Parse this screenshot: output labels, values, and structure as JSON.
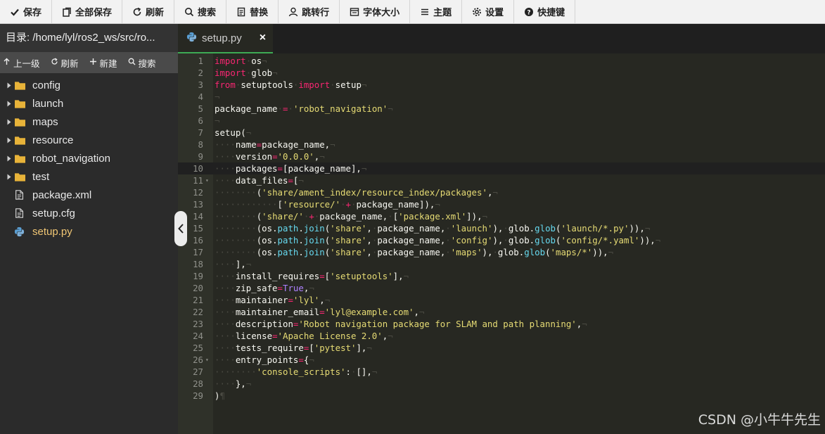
{
  "toolbar": {
    "save": "保存",
    "save_all": "全部保存",
    "refresh": "刷新",
    "search": "搜索",
    "replace": "替换",
    "goto_line": "跳转行",
    "font_size": "字体大小",
    "theme": "主题",
    "settings": "设置",
    "shortcuts": "快捷键"
  },
  "sidebar": {
    "path_label": "目录: /home/lyl/ros2_ws/src/ro...",
    "actions": {
      "up": "上一级",
      "refresh": "刷新",
      "new": "新建",
      "search": "搜索"
    },
    "folders": [
      "config",
      "launch",
      "maps",
      "resource",
      "robot_navigation",
      "test"
    ],
    "files": [
      "package.xml",
      "setup.cfg",
      "setup.py"
    ]
  },
  "tab": {
    "title": "setup.py",
    "close": "×"
  },
  "editor": {
    "current_line": 10,
    "lines": [
      [
        [
          "k",
          "import"
        ],
        [
          "w",
          " "
        ],
        [
          "t",
          "os"
        ]
      ],
      [
        [
          "k",
          "import"
        ],
        [
          "w",
          " "
        ],
        [
          "t",
          "glob"
        ]
      ],
      [
        [
          "k",
          "from"
        ],
        [
          "w",
          " "
        ],
        [
          "t",
          "setuptools"
        ],
        [
          "w",
          " "
        ],
        [
          "k",
          "import"
        ],
        [
          "w",
          " "
        ],
        [
          "t",
          "setup"
        ]
      ],
      [],
      [
        [
          "t",
          "package_name"
        ],
        [
          "w",
          " "
        ],
        [
          "o",
          "="
        ],
        [
          "w",
          " "
        ],
        [
          "s",
          "'robot_navigation'"
        ]
      ],
      [],
      [
        [
          "t",
          "setup("
        ]
      ],
      [
        [
          "w",
          "    "
        ],
        [
          "t",
          "name"
        ],
        [
          "o",
          "="
        ],
        [
          "t",
          "package_name,"
        ]
      ],
      [
        [
          "w",
          "    "
        ],
        [
          "t",
          "version"
        ],
        [
          "o",
          "="
        ],
        [
          "s",
          "'0.0.0'"
        ],
        [
          "t",
          ","
        ]
      ],
      [
        [
          "w",
          "    "
        ],
        [
          "t",
          "packages"
        ],
        [
          "o",
          "="
        ],
        [
          "t",
          "[package_name],"
        ]
      ],
      [
        [
          "w",
          "    "
        ],
        [
          "t",
          "data_files"
        ],
        [
          "o",
          "="
        ],
        [
          "t",
          "["
        ]
      ],
      [
        [
          "w",
          "        "
        ],
        [
          "t",
          "("
        ],
        [
          "s",
          "'share/ament_index/resource_index/packages'"
        ],
        [
          "t",
          ","
        ]
      ],
      [
        [
          "w",
          "            "
        ],
        [
          "t",
          "["
        ],
        [
          "s",
          "'resource/'"
        ],
        [
          "w",
          " "
        ],
        [
          "o",
          "+"
        ],
        [
          "w",
          " "
        ],
        [
          "t",
          "package_name]),"
        ]
      ],
      [
        [
          "w",
          "        "
        ],
        [
          "t",
          "("
        ],
        [
          "s",
          "'share/'"
        ],
        [
          "w",
          " "
        ],
        [
          "o",
          "+"
        ],
        [
          "w",
          " "
        ],
        [
          "t",
          "package_name,"
        ],
        [
          "w",
          " "
        ],
        [
          "t",
          "["
        ],
        [
          "s",
          "'package.xml'"
        ],
        [
          "t",
          "]),"
        ]
      ],
      [
        [
          "w",
          "        "
        ],
        [
          "t",
          "(os."
        ],
        [
          "f",
          "path"
        ],
        [
          "t",
          "."
        ],
        [
          "f",
          "join"
        ],
        [
          "t",
          "("
        ],
        [
          "s",
          "'share'"
        ],
        [
          "t",
          ","
        ],
        [
          "w",
          " "
        ],
        [
          "t",
          "package_name,"
        ],
        [
          "w",
          " "
        ],
        [
          "s",
          "'launch'"
        ],
        [
          "t",
          "),"
        ],
        [
          "w",
          " "
        ],
        [
          "t",
          "glob."
        ],
        [
          "f",
          "glob"
        ],
        [
          "t",
          "("
        ],
        [
          "s",
          "'launch/*.py'"
        ],
        [
          "t",
          ")),"
        ]
      ],
      [
        [
          "w",
          "        "
        ],
        [
          "t",
          "(os."
        ],
        [
          "f",
          "path"
        ],
        [
          "t",
          "."
        ],
        [
          "f",
          "join"
        ],
        [
          "t",
          "("
        ],
        [
          "s",
          "'share'"
        ],
        [
          "t",
          ","
        ],
        [
          "w",
          " "
        ],
        [
          "t",
          "package_name,"
        ],
        [
          "w",
          " "
        ],
        [
          "s",
          "'config'"
        ],
        [
          "t",
          "),"
        ],
        [
          "w",
          " "
        ],
        [
          "t",
          "glob."
        ],
        [
          "f",
          "glob"
        ],
        [
          "t",
          "("
        ],
        [
          "s",
          "'config/*.yaml'"
        ],
        [
          "t",
          ")),"
        ]
      ],
      [
        [
          "w",
          "        "
        ],
        [
          "t",
          "(os."
        ],
        [
          "f",
          "path"
        ],
        [
          "t",
          "."
        ],
        [
          "f",
          "join"
        ],
        [
          "t",
          "("
        ],
        [
          "s",
          "'share'"
        ],
        [
          "t",
          ","
        ],
        [
          "w",
          " "
        ],
        [
          "t",
          "package_name,"
        ],
        [
          "w",
          " "
        ],
        [
          "s",
          "'maps'"
        ],
        [
          "t",
          "),"
        ],
        [
          "w",
          " "
        ],
        [
          "t",
          "glob."
        ],
        [
          "f",
          "glob"
        ],
        [
          "t",
          "("
        ],
        [
          "s",
          "'maps/*'"
        ],
        [
          "t",
          ")),"
        ]
      ],
      [
        [
          "w",
          "    "
        ],
        [
          "t",
          "],"
        ]
      ],
      [
        [
          "w",
          "    "
        ],
        [
          "t",
          "install_requires"
        ],
        [
          "o",
          "="
        ],
        [
          "t",
          "["
        ],
        [
          "s",
          "'setuptools'"
        ],
        [
          "t",
          "],"
        ]
      ],
      [
        [
          "w",
          "    "
        ],
        [
          "t",
          "zip_safe"
        ],
        [
          "o",
          "="
        ],
        [
          "b",
          "True"
        ],
        [
          "t",
          ","
        ]
      ],
      [
        [
          "w",
          "    "
        ],
        [
          "t",
          "maintainer"
        ],
        [
          "o",
          "="
        ],
        [
          "s",
          "'lyl'"
        ],
        [
          "t",
          ","
        ]
      ],
      [
        [
          "w",
          "    "
        ],
        [
          "t",
          "maintainer_email"
        ],
        [
          "o",
          "="
        ],
        [
          "s",
          "'lyl@example.com'"
        ],
        [
          "t",
          ","
        ]
      ],
      [
        [
          "w",
          "    "
        ],
        [
          "t",
          "description"
        ],
        [
          "o",
          "="
        ],
        [
          "s",
          "'Robot navigation package for SLAM and path planning'"
        ],
        [
          "t",
          ","
        ]
      ],
      [
        [
          "w",
          "    "
        ],
        [
          "t",
          "license"
        ],
        [
          "o",
          "="
        ],
        [
          "s",
          "'Apache License 2.0'"
        ],
        [
          "t",
          ","
        ]
      ],
      [
        [
          "w",
          "    "
        ],
        [
          "t",
          "tests_require"
        ],
        [
          "o",
          "="
        ],
        [
          "t",
          "["
        ],
        [
          "s",
          "'pytest'"
        ],
        [
          "t",
          "],"
        ]
      ],
      [
        [
          "w",
          "    "
        ],
        [
          "t",
          "entry_points"
        ],
        [
          "o",
          "="
        ],
        [
          "t",
          "{"
        ]
      ],
      [
        [
          "w",
          "        "
        ],
        [
          "s",
          "'console_scripts'"
        ],
        [
          "t",
          ":"
        ],
        [
          "w",
          " "
        ],
        [
          "t",
          "[],"
        ]
      ],
      [
        [
          "w",
          "    "
        ],
        [
          "t",
          "},"
        ]
      ],
      [
        [
          "t",
          ")"
        ]
      ]
    ],
    "fold_lines": [
      11,
      26
    ]
  },
  "watermark": "CSDN @小牛牛先生",
  "colors": {
    "accent_tab": "#3daa54",
    "folder": "#e8b339",
    "python_icon": "#5a9fd4"
  }
}
